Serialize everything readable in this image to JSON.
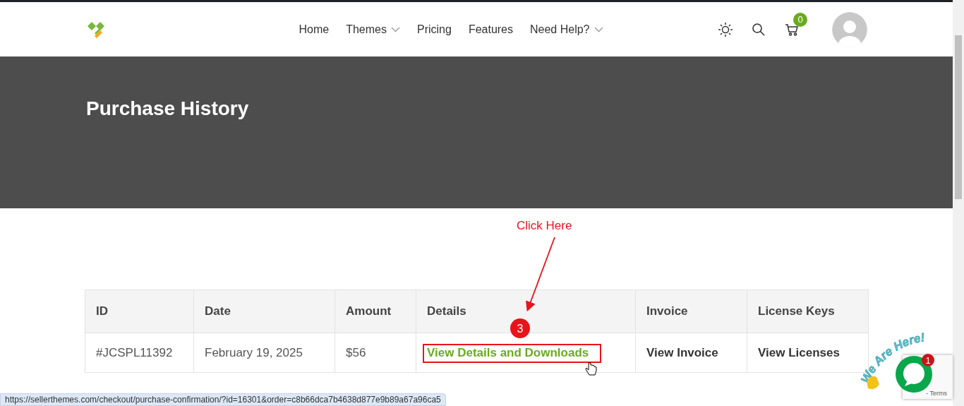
{
  "nav": {
    "items": [
      {
        "label": "Home",
        "dropdown": false
      },
      {
        "label": "Themes",
        "dropdown": true
      },
      {
        "label": "Pricing",
        "dropdown": false
      },
      {
        "label": "Features",
        "dropdown": false
      },
      {
        "label": "Need Help?",
        "dropdown": true
      }
    ]
  },
  "header": {
    "cart_count": "0"
  },
  "hero": {
    "title": "Purchase History"
  },
  "table": {
    "columns": [
      "ID",
      "Date",
      "Amount",
      "Details",
      "Invoice",
      "License Keys"
    ],
    "rows": [
      {
        "cells": [
          {
            "text": "#JCSPL11392",
            "kind": "plain"
          },
          {
            "text": "February 19, 2025",
            "kind": "plain"
          },
          {
            "text": "$56",
            "kind": "plain"
          },
          {
            "text": "View Details and Downloads",
            "kind": "primary-link"
          },
          {
            "text": "View Invoice",
            "kind": "link"
          },
          {
            "text": "View Licenses",
            "kind": "link"
          }
        ]
      }
    ]
  },
  "annotation": {
    "label": "Click Here",
    "step": "3"
  },
  "chat": {
    "title": "We Are Here!",
    "unread": "1"
  },
  "recaptcha": {
    "links": "- Terms"
  },
  "status_bar": {
    "url": "https://sellerthemes.com/checkout/purchase-confirmation/?id=16301&order=c8b66dca7b4638d877e9b89a67a96ca5"
  }
}
